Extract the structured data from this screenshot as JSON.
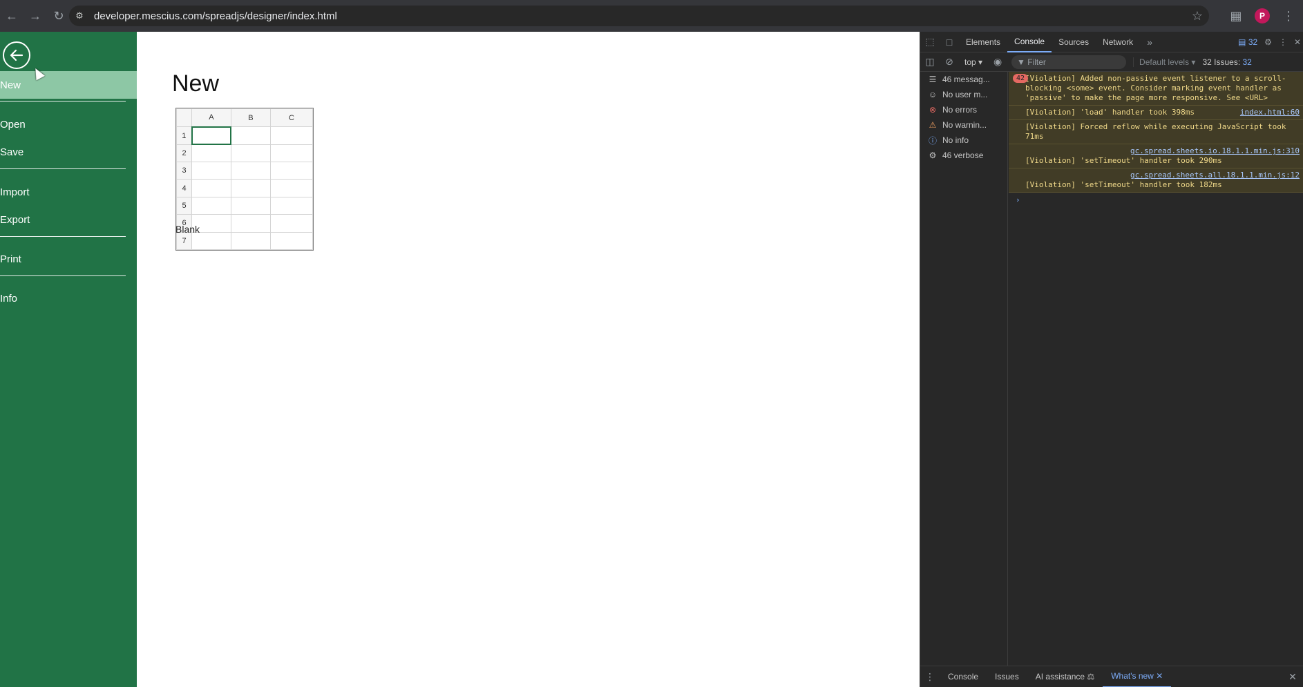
{
  "browser": {
    "url": "developer.mescius.com/spreadjs/designer/index.html",
    "profile_initial": "P"
  },
  "sidebar": {
    "items": [
      {
        "label": "New",
        "active": true
      },
      {
        "label": "Open"
      },
      {
        "label": "Save"
      },
      {
        "label": "Import"
      },
      {
        "label": "Export"
      },
      {
        "label": "Print"
      },
      {
        "label": "Info"
      }
    ]
  },
  "content": {
    "title": "New",
    "template": {
      "columns": [
        "A",
        "B",
        "C"
      ],
      "rows": [
        "1",
        "2",
        "3",
        "4",
        "5",
        "6",
        "7"
      ],
      "label": "Blank"
    }
  },
  "devtools": {
    "tabs": [
      "Elements",
      "Console",
      "Sources",
      "Network"
    ],
    "active_tab": "Console",
    "issues_badge": "32",
    "context": "top",
    "filter_placeholder": "Filter",
    "levels": "Default levels",
    "issues_label": "32 Issues:",
    "issues_count": "32",
    "sidebar": [
      {
        "icon": "list-icon",
        "label": "46 messag..."
      },
      {
        "icon": "user-icon",
        "label": "No user m..."
      },
      {
        "icon": "error-icon",
        "label": "No errors"
      },
      {
        "icon": "warning-icon",
        "label": "No warnin..."
      },
      {
        "icon": "info-icon",
        "label": "No info"
      },
      {
        "icon": "bug-icon",
        "label": "46 verbose"
      }
    ],
    "messages": [
      {
        "count": "42",
        "text": "[Violation] Added non-passive event listener to a scroll-blocking <some> event. Consider marking event handler as 'passive' to make the page more responsive. See <URL>",
        "source": ""
      },
      {
        "count": "",
        "text": "[Violation] 'load' handler took 398ms",
        "source": "index.html:60"
      },
      {
        "count": "",
        "text": "[Violation] Forced reflow while executing JavaScript took 71ms",
        "source": ""
      },
      {
        "count": "",
        "text": "[Violation] 'setTimeout' handler took 290ms",
        "source": "gc.spread.sheets.io.18.1.1.min.js:310"
      },
      {
        "count": "",
        "text": "[Violation] 'setTimeout' handler took 182ms",
        "source": "gc.spread.sheets.all.18.1.1.min.js:12"
      }
    ],
    "drawer_tabs": [
      "Console",
      "Issues",
      "AI assistance",
      "What's new"
    ],
    "active_drawer": "What's new"
  }
}
